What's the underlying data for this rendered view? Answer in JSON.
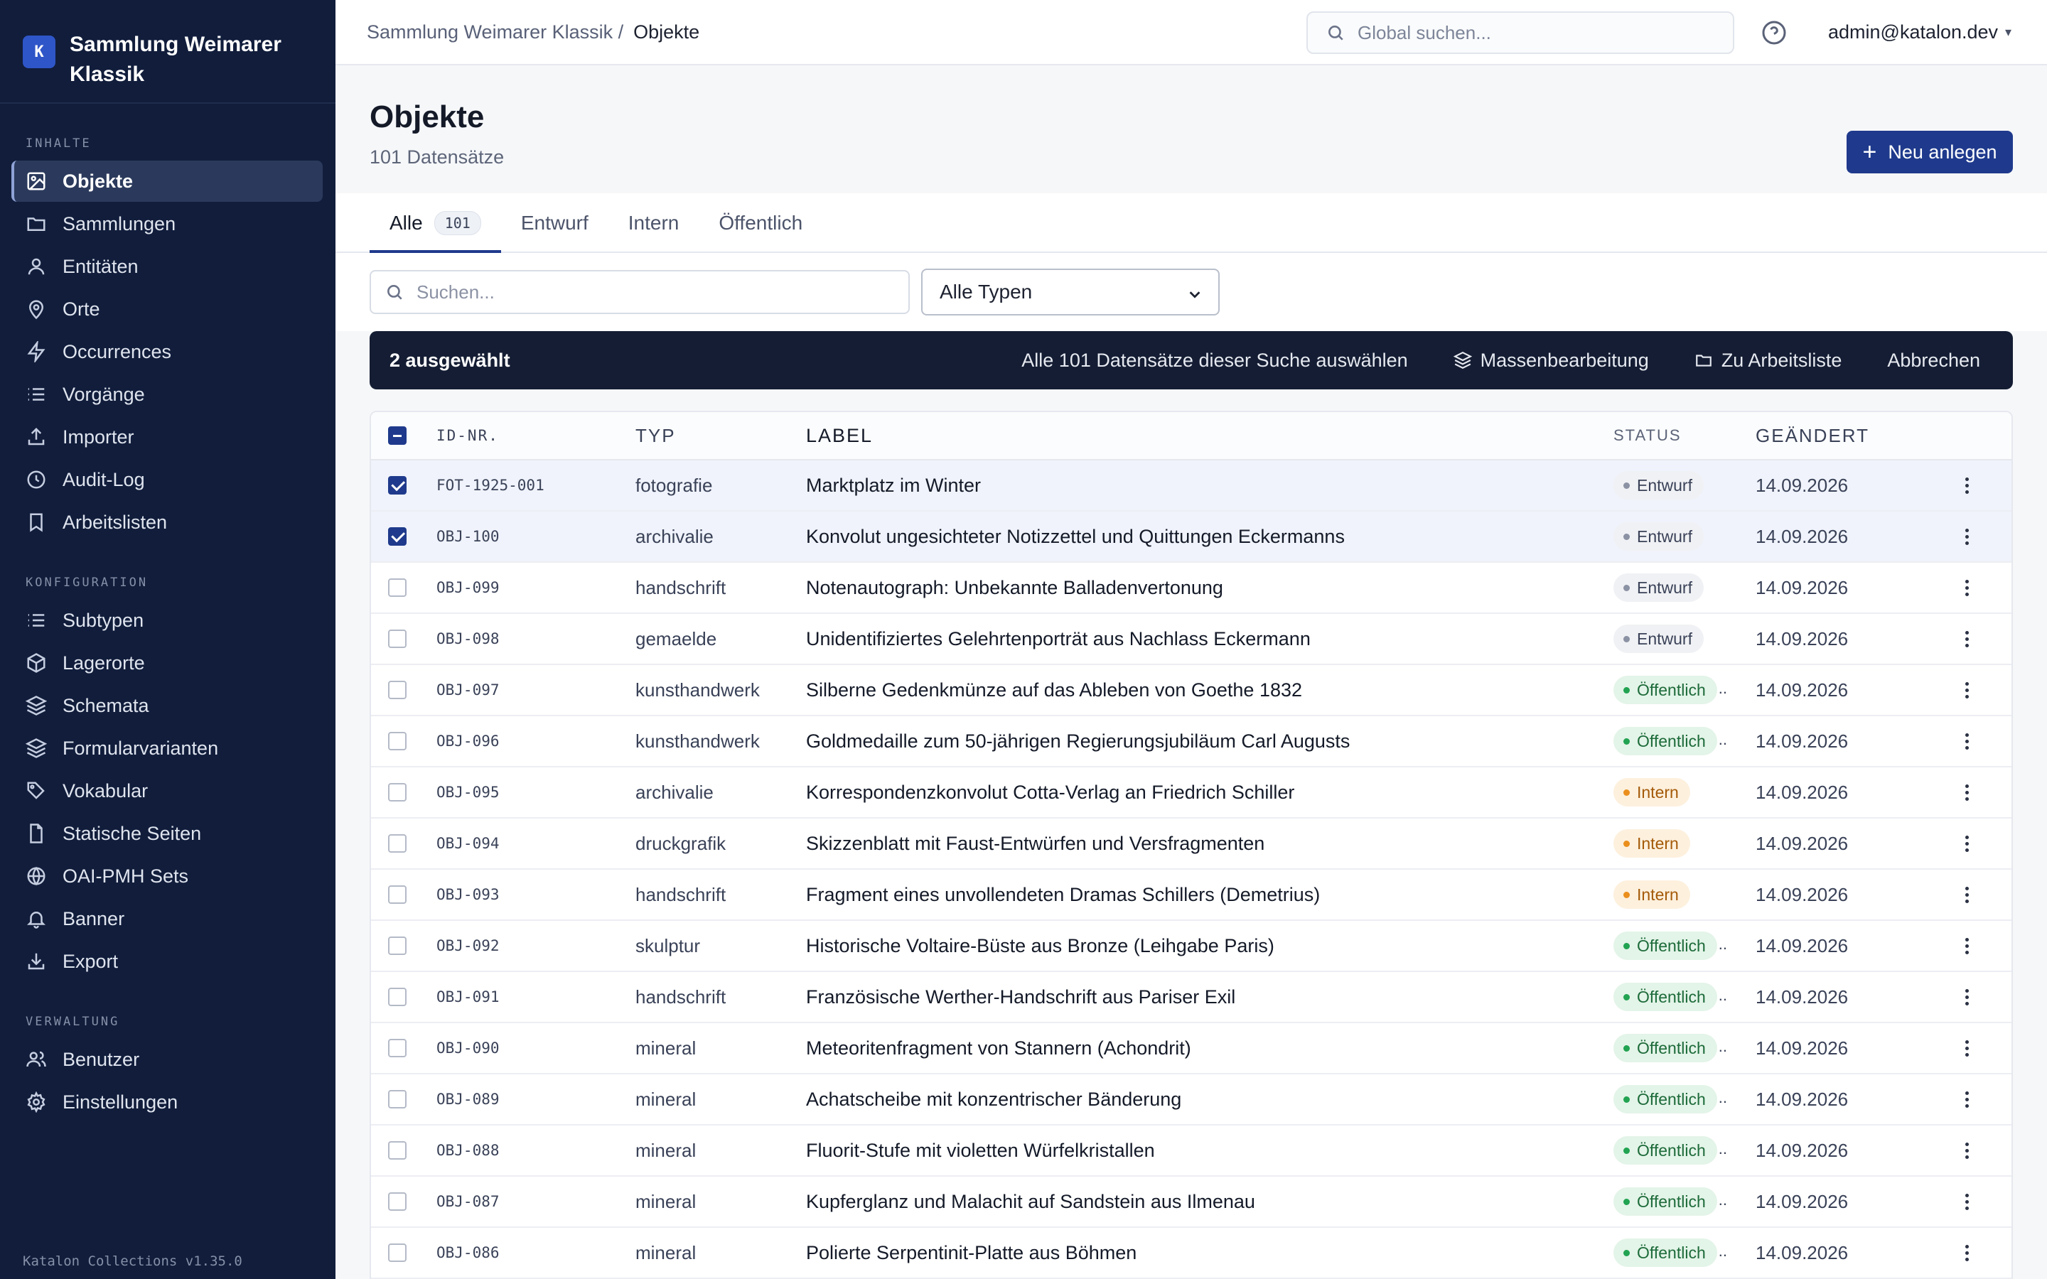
{
  "app": {
    "logo_letter": "K",
    "title": "Sammlung Weimarer Klassik",
    "version": "Katalon Collections v1.35.0"
  },
  "sidebar": {
    "sections": [
      {
        "label": "INHALTE",
        "items": [
          {
            "label": "Objekte",
            "icon": "image-icon",
            "active": true
          },
          {
            "label": "Sammlungen",
            "icon": "folder-icon"
          },
          {
            "label": "Entitäten",
            "icon": "user-icon"
          },
          {
            "label": "Orte",
            "icon": "map-pin-icon"
          },
          {
            "label": "Occurrences",
            "icon": "lightning-icon"
          },
          {
            "label": "Vorgänge",
            "icon": "list-icon"
          },
          {
            "label": "Importer",
            "icon": "upload-icon"
          },
          {
            "label": "Audit-Log",
            "icon": "clock-icon"
          },
          {
            "label": "Arbeitslisten",
            "icon": "bookmark-icon"
          }
        ]
      },
      {
        "label": "KONFIGURATION",
        "items": [
          {
            "label": "Subtypen",
            "icon": "list-icon"
          },
          {
            "label": "Lagerorte",
            "icon": "box-icon"
          },
          {
            "label": "Schemata",
            "icon": "layers-icon"
          },
          {
            "label": "Formularvarianten",
            "icon": "layers-icon"
          },
          {
            "label": "Vokabular",
            "icon": "tag-icon"
          },
          {
            "label": "Statische Seiten",
            "icon": "file-icon"
          },
          {
            "label": "OAI-PMH Sets",
            "icon": "globe-icon"
          },
          {
            "label": "Banner",
            "icon": "bell-icon"
          },
          {
            "label": "Export",
            "icon": "download-icon"
          }
        ]
      },
      {
        "label": "VERWALTUNG",
        "items": [
          {
            "label": "Benutzer",
            "icon": "users-icon"
          },
          {
            "label": "Einstellungen",
            "icon": "gear-icon"
          }
        ]
      }
    ]
  },
  "header": {
    "breadcrumb_parent": "Sammlung Weimarer Klassik /",
    "breadcrumb_current": "Objekte",
    "search_placeholder": "Global suchen...",
    "user": "admin@katalon.dev",
    "user_caret": "▾"
  },
  "page": {
    "title": "Objekte",
    "count": "101 Datensätze",
    "new_button": "Neu anlegen",
    "new_button_icon": "+"
  },
  "tabs": [
    {
      "label": "Alle",
      "badge": "101",
      "active": true
    },
    {
      "label": "Entwurf"
    },
    {
      "label": "Intern"
    },
    {
      "label": "Öffentlich"
    }
  ],
  "filters": {
    "search_placeholder": "Suchen...",
    "type_selected": "Alle Typen"
  },
  "bulk": {
    "count": "2 ausgewählt",
    "select_all": "Alle 101 Datensätze dieser Suche auswählen",
    "mass_edit": "Massenbearbeitung",
    "worklist": "Zu Arbeitsliste",
    "cancel": "Abbrechen"
  },
  "table": {
    "headers": {
      "id": "ID-NR.",
      "type": "TYP",
      "label": "LABEL",
      "status": "STATUS",
      "changed": "GEÄNDERT"
    },
    "rows": [
      {
        "id": "FOT-1925-001",
        "type": "fotografie",
        "label": "Marktplatz im Winter",
        "status": "Entwurf",
        "status_key": "entwurf",
        "date": "14.09.2026",
        "selected": true
      },
      {
        "id": "OBJ-100",
        "type": "archivalie",
        "label": "Konvolut ungesichteter Notizzettel und Quittungen Eckermanns",
        "status": "Entwurf",
        "status_key": "entwurf",
        "date": "14.09.2026",
        "selected": true
      },
      {
        "id": "OBJ-099",
        "type": "handschrift",
        "label": "Notenautograph: Unbekannte Balladenvertonung",
        "status": "Entwurf",
        "status_key": "entwurf",
        "date": "14.09.2026",
        "selected": false
      },
      {
        "id": "OBJ-098",
        "type": "gemaelde",
        "label": "Unidentifiziertes Gelehrtenporträt aus Nachlass Eckermann",
        "status": "Entwurf",
        "status_key": "entwurf",
        "date": "14.09.2026",
        "selected": false
      },
      {
        "id": "OBJ-097",
        "type": "kunsthandwerk",
        "label": "Silberne Gedenkmünze auf das Ableben von Goethe 1832",
        "status": "Öffentlich",
        "status_key": "oeffentlich",
        "date": "14.09.2026",
        "selected": false
      },
      {
        "id": "OBJ-096",
        "type": "kunsthandwerk",
        "label": "Goldmedaille zum 50-jährigen Regierungsjubiläum Carl Augusts",
        "status": "Öffentlich",
        "status_key": "oeffentlich",
        "date": "14.09.2026",
        "selected": false
      },
      {
        "id": "OBJ-095",
        "type": "archivalie",
        "label": "Korrespondenzkonvolut Cotta-Verlag an Friedrich Schiller",
        "status": "Intern",
        "status_key": "intern",
        "date": "14.09.2026",
        "selected": false
      },
      {
        "id": "OBJ-094",
        "type": "druckgrafik",
        "label": "Skizzenblatt mit Faust-Entwürfen und Versfragmenten",
        "status": "Intern",
        "status_key": "intern",
        "date": "14.09.2026",
        "selected": false
      },
      {
        "id": "OBJ-093",
        "type": "handschrift",
        "label": "Fragment eines unvollendeten Dramas Schillers (Demetrius)",
        "status": "Intern",
        "status_key": "intern",
        "date": "14.09.2026",
        "selected": false
      },
      {
        "id": "OBJ-092",
        "type": "skulptur",
        "label": "Historische Voltaire-Büste aus Bronze (Leihgabe Paris)",
        "status": "Öffentlich",
        "status_key": "oeffentlich",
        "date": "14.09.2026",
        "selected": false
      },
      {
        "id": "OBJ-091",
        "type": "handschrift",
        "label": "Französische Werther-Handschrift aus Pariser Exil",
        "status": "Öffentlich",
        "status_key": "oeffentlich",
        "date": "14.09.2026",
        "selected": false
      },
      {
        "id": "OBJ-090",
        "type": "mineral",
        "label": "Meteoritenfragment von Stannern (Achondrit)",
        "status": "Öffentlich",
        "status_key": "oeffentlich",
        "date": "14.09.2026",
        "selected": false
      },
      {
        "id": "OBJ-089",
        "type": "mineral",
        "label": "Achatscheibe mit konzentrischer Bänderung",
        "status": "Öffentlich",
        "status_key": "oeffentlich",
        "date": "14.09.2026",
        "selected": false
      },
      {
        "id": "OBJ-088",
        "type": "mineral",
        "label": "Fluorit-Stufe mit violetten Würfelkristallen",
        "status": "Öffentlich",
        "status_key": "oeffentlich",
        "date": "14.09.2026",
        "selected": false
      },
      {
        "id": "OBJ-087",
        "type": "mineral",
        "label": "Kupferglanz und Malachit auf Sandstein aus Ilmenau",
        "status": "Öffentlich",
        "status_key": "oeffentlich",
        "date": "14.09.2026",
        "selected": false
      },
      {
        "id": "OBJ-086",
        "type": "mineral",
        "label": "Polierte Serpentinit-Platte aus Böhmen",
        "status": "Öffentlich",
        "status_key": "oeffentlich",
        "date": "14.09.2026",
        "selected": false
      }
    ]
  },
  "colors": {
    "sidebar_bg": "#111d3b",
    "accent": "#1f3a8c",
    "bulkbar_bg": "#141d33"
  }
}
